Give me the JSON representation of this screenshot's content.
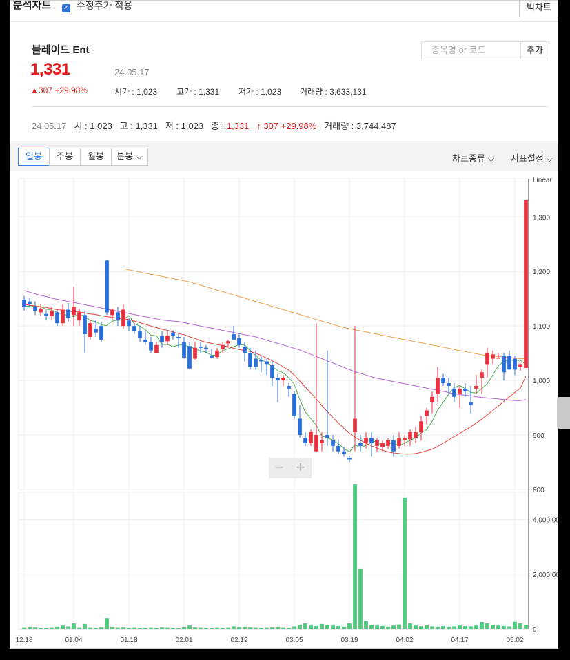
{
  "header": {
    "title": "분석차트",
    "adjusted_label": "수정주가 적용",
    "adjusted_checked": true,
    "big_chart_label": "빅차트"
  },
  "stock": {
    "name": "블레이드 Ent",
    "price": "1,331",
    "date": "24.05.17",
    "change": "307",
    "change_pct": "+29.98%",
    "open_label": "시가 : ",
    "open": "1,023",
    "high_label": "고가 : ",
    "high": "1,331",
    "low_label": "저가 : ",
    "low": "1,023",
    "volume_label": "거래량 : ",
    "volume": "3,633,131"
  },
  "search": {
    "placeholder": "종목명 or 코드",
    "add_label": "추가"
  },
  "ohlc_line": {
    "date": "24.05.17",
    "open_label": "시 : ",
    "open": "1,023",
    "high_label": "고 : ",
    "high": "1,331",
    "low_label": "저 : ",
    "low": "1,023",
    "close_label": "종 : ",
    "close": "1,331",
    "change": "↑ 307",
    "change_pct": "+29.98%",
    "volume_label": "거래량 : ",
    "volume": "3,744,487"
  },
  "tabs": [
    {
      "label": "일봉",
      "active": true
    },
    {
      "label": "주봉",
      "active": false
    },
    {
      "label": "월봉",
      "active": false
    },
    {
      "label": "분봉",
      "active": false
    }
  ],
  "menus": {
    "chart_type": "차트종류",
    "indicator": "지표설정"
  },
  "zoom": {
    "minus": "−",
    "plus": "+"
  },
  "colors": {
    "up": "#e8313f",
    "down": "#2b6fd6",
    "volume": "#4fc97d",
    "ma5": "#4caf50",
    "ma20": "#e8453c",
    "ma60": "#b865d9",
    "ma120": "#f0a050"
  },
  "chart_data": {
    "type": "candlestick",
    "scale": "Linear",
    "price_axis": {
      "ticks": [
        800,
        900,
        1000,
        1100,
        1200,
        1300
      ],
      "labels": [
        "800",
        "900",
        "1,000",
        "1,100",
        "1,200",
        "1,300"
      ],
      "range": [
        800,
        1370
      ]
    },
    "volume_axis": {
      "ticks": [
        0,
        2000000,
        4000000
      ],
      "labels": [
        "0",
        "2,000,000",
        "4,000,000"
      ],
      "range": [
        0,
        5000000
      ]
    },
    "date_labels": [
      "12.18",
      "01.04",
      "01.18",
      "02.01",
      "02.19",
      "03.05",
      "03.19",
      "04.02",
      "04.17",
      "05.02"
    ],
    "date_label_index": [
      0,
      9,
      19,
      29,
      39,
      49,
      59,
      69,
      79,
      89
    ],
    "ohlc": [
      [
        1148,
        1155,
        1128,
        1135
      ],
      [
        1145,
        1152,
        1135,
        1140
      ],
      [
        1135,
        1145,
        1120,
        1128
      ],
      [
        1125,
        1140,
        1118,
        1132
      ],
      [
        1122,
        1130,
        1110,
        1118
      ],
      [
        1118,
        1135,
        1110,
        1128
      ],
      [
        1125,
        1130,
        1100,
        1105
      ],
      [
        1105,
        1140,
        1100,
        1130
      ],
      [
        1130,
        1142,
        1108,
        1115
      ],
      [
        1120,
        1172,
        1100,
        1135
      ],
      [
        1110,
        1132,
        1100,
        1125
      ],
      [
        1120,
        1128,
        1050,
        1085
      ],
      [
        1080,
        1110,
        1075,
        1105
      ],
      [
        1095,
        1110,
        1080,
        1088
      ],
      [
        1100,
        1108,
        1070,
        1075
      ],
      [
        1220,
        1222,
        1120,
        1125
      ],
      [
        1120,
        1132,
        1110,
        1130
      ],
      [
        1125,
        1135,
        1100,
        1110
      ],
      [
        1100,
        1140,
        1095,
        1130
      ],
      [
        1110,
        1115,
        1090,
        1100
      ],
      [
        1100,
        1105,
        1085,
        1090
      ],
      [
        1090,
        1100,
        1070,
        1078
      ],
      [
        1075,
        1090,
        1065,
        1070
      ],
      [
        1070,
        1080,
        1050,
        1055
      ],
      [
        1050,
        1070,
        1050,
        1065
      ],
      [
        1082,
        1090,
        1060,
        1070
      ],
      [
        1072,
        1090,
        1065,
        1082
      ],
      [
        1088,
        1092,
        1075,
        1082
      ],
      [
        1080,
        1085,
        1060,
        1078
      ],
      [
        1070,
        1080,
        1040,
        1042
      ],
      [
        1063,
        1070,
        1020,
        1022
      ],
      [
        1040,
        1070,
        1038,
        1060
      ],
      [
        1062,
        1070,
        1050,
        1060
      ],
      [
        1060,
        1065,
        1050,
        1058
      ],
      [
        1045,
        1058,
        1040,
        1042
      ],
      [
        1043,
        1060,
        1040,
        1055
      ],
      [
        1058,
        1070,
        1050,
        1065
      ],
      [
        1068,
        1075,
        1060,
        1072
      ],
      [
        1085,
        1100,
        1075,
        1075
      ],
      [
        1078,
        1085,
        1060,
        1065
      ],
      [
        1062,
        1070,
        1035,
        1050
      ],
      [
        1050,
        1060,
        1020,
        1025
      ],
      [
        1040,
        1055,
        1020,
        1025
      ],
      [
        1038,
        1045,
        1015,
        1035
      ],
      [
        1035,
        1040,
        1010,
        1030
      ],
      [
        1028,
        1035,
        990,
        1005
      ],
      [
        1005,
        1012,
        960,
        1000
      ],
      [
        1000,
        1010,
        990,
        1005
      ],
      [
        990,
        995,
        970,
        985
      ],
      [
        975,
        980,
        930,
        935
      ],
      [
        930,
        955,
        895,
        900
      ],
      [
        895,
        905,
        880,
        885
      ],
      [
        885,
        910,
        880,
        905
      ],
      [
        870,
        1105,
        870,
        900
      ],
      [
        885,
        905,
        870,
        890
      ],
      [
        900,
        1055,
        880,
        895
      ],
      [
        890,
        900,
        870,
        880
      ],
      [
        880,
        892,
        865,
        870
      ],
      [
        870,
        878,
        860,
        865
      ],
      [
        858,
        862,
        850,
        855
      ],
      [
        905,
        1100,
        870,
        930
      ],
      [
        885,
        900,
        870,
        880
      ],
      [
        885,
        905,
        875,
        895
      ],
      [
        895,
        905,
        860,
        885
      ],
      [
        880,
        895,
        870,
        890
      ],
      [
        878,
        890,
        870,
        885
      ],
      [
        880,
        895,
        875,
        890
      ],
      [
        890,
        900,
        860,
        870
      ],
      [
        880,
        905,
        875,
        895
      ],
      [
        890,
        900,
        880,
        895
      ],
      [
        892,
        910,
        880,
        905
      ],
      [
        895,
        915,
        885,
        905
      ],
      [
        905,
        935,
        890,
        925
      ],
      [
        935,
        950,
        920,
        945
      ],
      [
        960,
        980,
        940,
        970
      ],
      [
        975,
        1025,
        960,
        1005
      ],
      [
        1005,
        1012,
        990,
        995
      ],
      [
        995,
        1005,
        975,
        990
      ],
      [
        985,
        995,
        960,
        970
      ],
      [
        975,
        990,
        950,
        985
      ],
      [
        985,
        995,
        970,
        980
      ],
      [
        960,
        990,
        940,
        955
      ],
      [
        985,
        1010,
        975,
        990
      ],
      [
        1005,
        1020,
        975,
        1015
      ],
      [
        1030,
        1060,
        1005,
        1050
      ],
      [
        1040,
        1055,
        1030,
        1048
      ],
      [
        1040,
        1050,
        1040,
        1042
      ],
      [
        1045,
        1050,
        1000,
        1015
      ],
      [
        1045,
        1055,
        1020,
        1020
      ],
      [
        1040,
        1045,
        1010,
        1020
      ],
      [
        1025,
        1032,
        1018,
        1030
      ],
      [
        1023,
        1331,
        1023,
        1331
      ]
    ],
    "volume": [
      60000,
      80000,
      70000,
      50000,
      40000,
      60000,
      80000,
      120000,
      90000,
      200000,
      60000,
      180000,
      60000,
      50000,
      70000,
      400000,
      80000,
      60000,
      70000,
      50000,
      60000,
      40000,
      50000,
      60000,
      50000,
      70000,
      60000,
      50000,
      40000,
      80000,
      120000,
      70000,
      60000,
      50000,
      40000,
      60000,
      50000,
      60000,
      90000,
      70000,
      80000,
      70000,
      60000,
      50000,
      60000,
      70000,
      80000,
      60000,
      50000,
      90000,
      150000,
      200000,
      120000,
      100000,
      180000,
      150000,
      120000,
      100000,
      80000,
      200000,
      5300000,
      2200000,
      300000,
      150000,
      120000,
      100000,
      80000,
      120000,
      160000,
      4800000,
      200000,
      120000,
      100000,
      150000,
      90000,
      80000,
      100000,
      80000,
      90000,
      120000,
      100000,
      90000,
      120000,
      250000,
      200000,
      150000,
      120000,
      100000,
      90000,
      260000,
      200000,
      150000,
      120000,
      100000,
      90000,
      3700000
    ],
    "moving_averages": [
      {
        "period": 5,
        "values": [
          1135,
          1137,
          1136,
          1135,
          1131,
          1129,
          1125,
          1121,
          1120,
          1117,
          1122,
          1117,
          1110,
          1108,
          1102,
          1101,
          1109,
          1111,
          1112,
          1119,
          1104,
          1100,
          1093,
          1083,
          1082,
          1066,
          1066,
          1062,
          1065,
          1065,
          1062,
          1058,
          1054,
          1052,
          1046,
          1047,
          1055,
          1058,
          1062,
          1066,
          1065,
          1055,
          1046,
          1037,
          1034,
          1026,
          1018,
          1014,
          1005,
          993,
          965,
          942,
          930,
          918,
          898,
          895,
          890,
          884,
          875,
          869,
          882,
          877,
          881,
          886,
          890,
          878,
          885,
          884,
          881,
          885,
          890,
          895,
          904,
          910,
          925,
          946,
          960,
          975,
          987,
          991,
          985,
          978,
          977,
          985,
          994,
          1010,
          1027,
          1035,
          1037,
          1037,
          1037,
          1029
        ]
      },
      {
        "period": 20,
        "values": [
          1140,
          1138,
          1137,
          1135,
          1134,
          1132,
          1130,
          1129,
          1127,
          1126,
          1126,
          1124,
          1122,
          1121,
          1119,
          1117,
          1116,
          1114,
          1113,
          1112,
          1109,
          1106,
          1103,
          1100,
          1097,
          1094,
          1092,
          1089,
          1086,
          1084,
          1080,
          1077,
          1073,
          1070,
          1068,
          1066,
          1064,
          1062,
          1059,
          1057,
          1055,
          1053,
          1050,
          1046,
          1041,
          1036,
          1031,
          1025,
          1019,
          1010,
          999,
          988,
          977,
          966,
          954,
          943,
          932,
          922,
          912,
          903,
          896,
          890,
          885,
          880,
          876,
          872,
          869,
          867,
          866,
          865,
          865,
          866,
          868,
          871,
          874,
          879,
          885,
          891,
          897,
          903,
          909,
          915,
          922,
          929,
          937,
          945,
          953,
          962,
          970,
          978,
          986,
          1008
        ]
      },
      {
        "period": 60,
        "values": [
          1165,
          1162,
          1159,
          1156,
          1154,
          1151,
          1149,
          1147,
          1145,
          1143,
          1141,
          1139,
          1137,
          1135,
          1133,
          1131,
          1129,
          1127,
          1125,
          1123,
          1121,
          1119,
          1117,
          1115,
          1113,
          1111,
          1110,
          1109,
          1108,
          1106,
          1104,
          1102,
          1100,
          1098,
          1096,
          1094,
          1092,
          1090,
          1088,
          1086,
          1084,
          1082,
          1080,
          1077,
          1074,
          1071,
          1068,
          1065,
          1062,
          1059,
          1056,
          1052,
          1048,
          1044,
          1040,
          1036,
          1032,
          1028,
          1024,
          1020,
          1016,
          1013,
          1010,
          1007,
          1004,
          1002,
          1000,
          998,
          996,
          994,
          992,
          990,
          988,
          986,
          984,
          982,
          980,
          978,
          976,
          974,
          973,
          972,
          970,
          969,
          968,
          967,
          966,
          965,
          964,
          963,
          963,
          965
        ]
      },
      {
        "period": 120,
        "values": [
          null,
          null,
          null,
          null,
          null,
          null,
          null,
          null,
          null,
          null,
          null,
          null,
          null,
          null,
          null,
          null,
          null,
          null,
          1205,
          1203,
          1201,
          1199,
          1197,
          1195,
          1193,
          1191,
          1189,
          1187,
          1185,
          1183,
          1181,
          1178,
          1175,
          1172,
          1169,
          1166,
          1163,
          1160,
          1157,
          1154,
          1151,
          1148,
          1145,
          1142,
          1139,
          1136,
          1133,
          1130,
          1127,
          1124,
          1121,
          1118,
          1115,
          1112,
          1109,
          1106,
          1103,
          1100,
          1097,
          1095,
          1093,
          1091,
          1089,
          1087,
          1085,
          1083,
          1081,
          1079,
          1077,
          1075,
          1073,
          1071,
          1069,
          1067,
          1065,
          1063,
          1061,
          1059,
          1057,
          1055,
          1053,
          1051,
          1049,
          1047,
          1046,
          1045,
          1044,
          1043,
          1042,
          1041,
          1040,
          1040
        ]
      }
    ]
  }
}
